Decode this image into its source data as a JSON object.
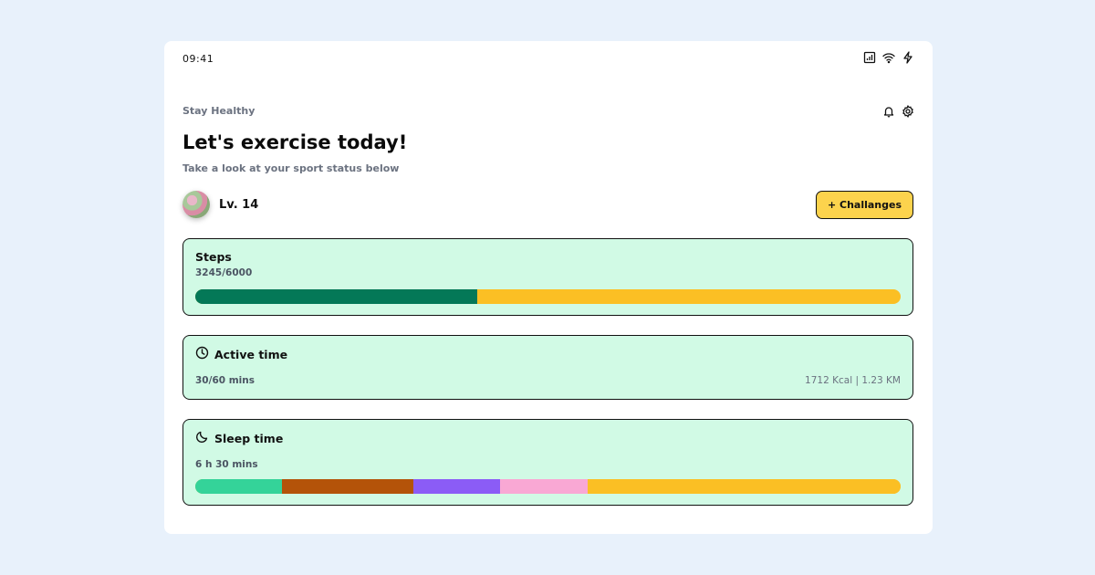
{
  "status_bar": {
    "time": "09:41"
  },
  "header": {
    "eyebrow": "Stay Healthy",
    "title": "Let's exercise today!",
    "subtitle": "Take a look at your sport status below"
  },
  "profile": {
    "level": "Lv. 14",
    "challenge_button": "+ Challanges"
  },
  "steps": {
    "title": "Steps",
    "value": "3245/6000",
    "progress_fraction": 0.4,
    "fill_color": "#047857",
    "track_color": "#fbbf24"
  },
  "active_time": {
    "title": "Active time",
    "value": "30/60 mins",
    "extra": "1712 Kcal | 1.23 KM"
  },
  "sleep_time": {
    "title": "Sleep time",
    "value": "6 h 30 mins",
    "segments": [
      {
        "color": "#34d399",
        "fraction": 0.123
      },
      {
        "color": "#b45309",
        "fraction": 0.186
      },
      {
        "color": "#8b5cf6",
        "fraction": 0.123
      },
      {
        "color": "#f9a8d4",
        "fraction": 0.124
      },
      {
        "color": "#fbbf24",
        "fraction": 0.444
      }
    ]
  }
}
